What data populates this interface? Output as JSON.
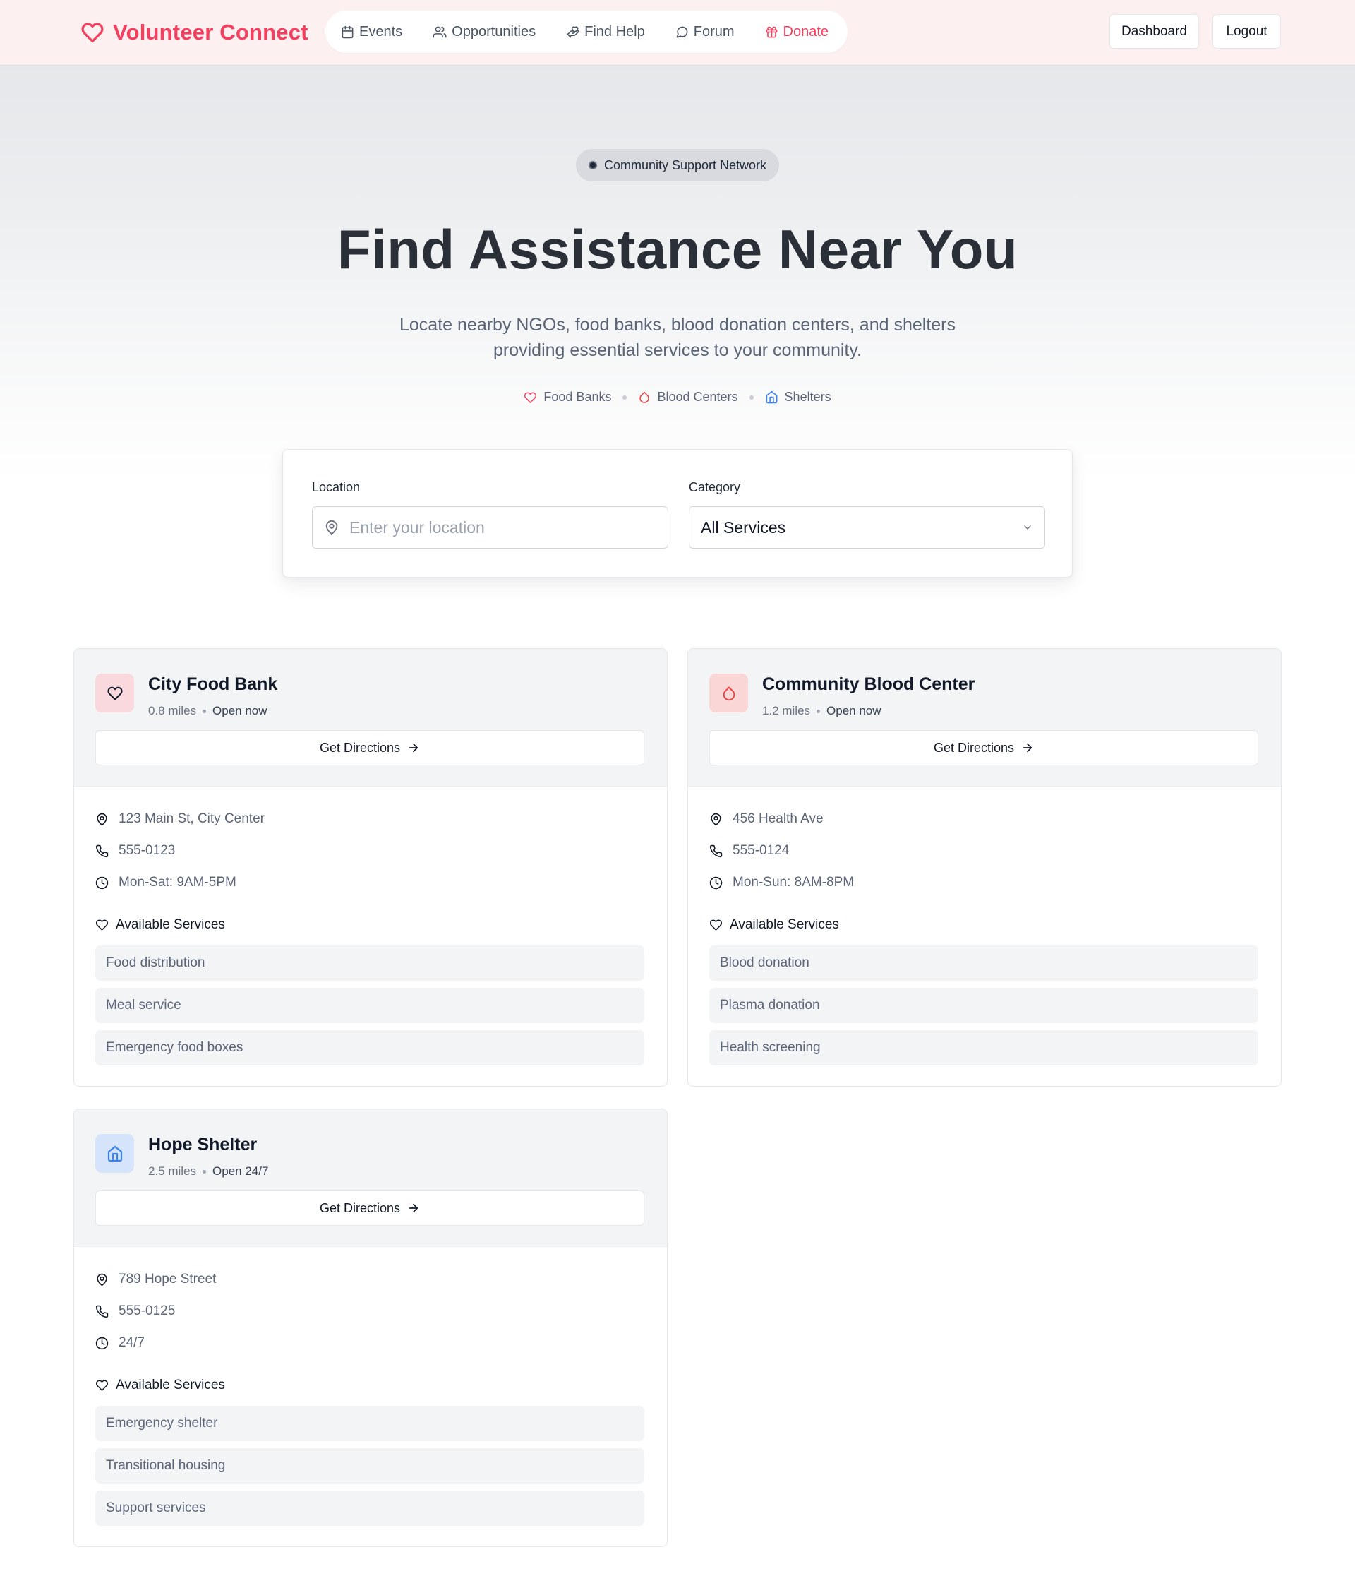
{
  "header": {
    "brand": "Volunteer Connect",
    "nav": [
      {
        "label": "Events",
        "icon": "calendar-icon"
      },
      {
        "label": "Opportunities",
        "icon": "users-icon"
      },
      {
        "label": "Find Help",
        "icon": "hand-heart-icon"
      },
      {
        "label": "Forum",
        "icon": "chat-bubble-icon"
      },
      {
        "label": "Donate",
        "icon": "gift-icon"
      }
    ],
    "dashboard_label": "Dashboard",
    "logout_label": "Logout"
  },
  "hero": {
    "badge": "Community Support Network",
    "title": "Find Assistance Near You",
    "subtitle": "Locate nearby NGOs, food banks, blood donation centers, and shelters providing essential services to your community.",
    "chips": [
      {
        "label": "Food Banks",
        "icon": "heart-icon"
      },
      {
        "label": "Blood Centers",
        "icon": "droplet-icon"
      },
      {
        "label": "Shelters",
        "icon": "home-icon"
      }
    ]
  },
  "search": {
    "location_label": "Location",
    "location_placeholder": "Enter your location",
    "category_label": "Category",
    "category_value": "All Services"
  },
  "cards": [
    {
      "name": "City Food Bank",
      "distance": "0.8 miles",
      "status": "Open now",
      "icon": "heart-icon",
      "directions_label": "Get Directions",
      "address": "123 Main St, City Center",
      "phone": "555-0123",
      "hours": "Mon-Sat: 9AM-5PM",
      "services_title": "Available Services",
      "services": [
        "Food distribution",
        "Meal service",
        "Emergency food boxes"
      ]
    },
    {
      "name": "Community Blood Center",
      "distance": "1.2 miles",
      "status": "Open now",
      "icon": "droplet-icon",
      "directions_label": "Get Directions",
      "address": "456 Health Ave",
      "phone": "555-0124",
      "hours": "Mon-Sun: 8AM-8PM",
      "services_title": "Available Services",
      "services": [
        "Blood donation",
        "Plasma donation",
        "Health screening"
      ]
    },
    {
      "name": "Hope Shelter",
      "distance": "2.5 miles",
      "status": "Open 24/7",
      "icon": "home-icon",
      "directions_label": "Get Directions",
      "address": "789 Hope Street",
      "phone": "555-0125",
      "hours": "24/7",
      "services_title": "Available Services",
      "services": [
        "Emergency shelter",
        "Transitional housing",
        "Support services"
      ]
    }
  ],
  "colors": {
    "brand": "#f43f5e",
    "header_bg": "#fdf0f0",
    "food_icon_bg": "#f9d9dd",
    "blood_icon_bg": "#fbd6d6",
    "shelter_icon_bg": "#d6e4fb",
    "shelter_blue": "#3b82f6"
  }
}
